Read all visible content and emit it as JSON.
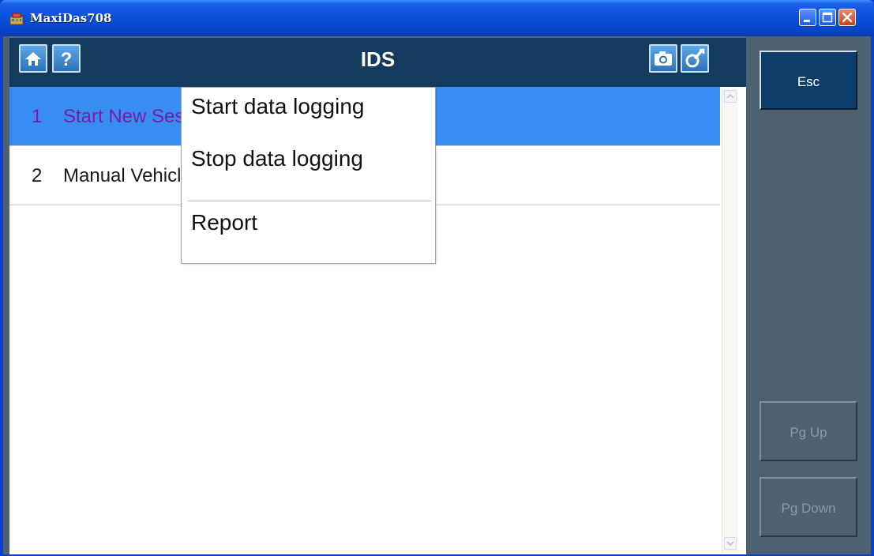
{
  "window": {
    "title": "MaxiDas708",
    "controls": [
      "minimize-icon",
      "maximize-icon",
      "close-icon"
    ]
  },
  "header": {
    "title": "IDS",
    "left_icons": [
      "home-icon",
      "help-icon"
    ],
    "right_icons": [
      "camera-icon",
      "settings-icon"
    ]
  },
  "list": {
    "items": [
      {
        "num": "1",
        "label": "Start New Session",
        "selected": true
      },
      {
        "num": "2",
        "label": "Manual Vehicle Selection",
        "selected": false
      }
    ]
  },
  "popup_menu": {
    "items": [
      "Start data logging",
      "Stop data logging",
      "Report"
    ]
  },
  "side_buttons": {
    "esc": "Esc",
    "pg_up": "Pg Up",
    "pg_down": "Pg Down"
  },
  "colors": {
    "header_bg": "#143a5d",
    "selected_row_bg": "#3a8cf5",
    "selected_row_text": "#7a1fa0",
    "side_panel_bg": "#4d6170",
    "esc_button_bg": "#0d3d6b"
  }
}
